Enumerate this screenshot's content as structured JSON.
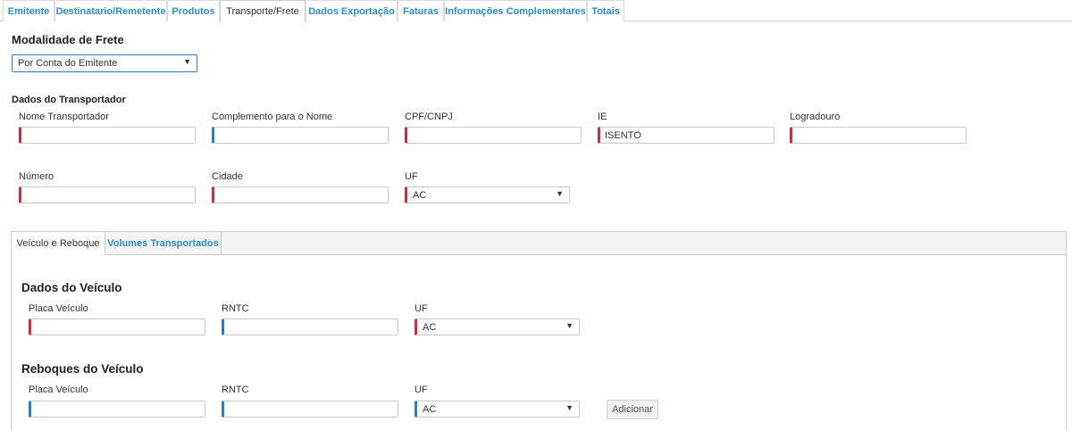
{
  "tabs": [
    {
      "label": "Emitente"
    },
    {
      "label": "Destinatario/Remetente"
    },
    {
      "label": "Produtos"
    },
    {
      "label": "Transporte/Frete"
    },
    {
      "label": "Dados Exportação"
    },
    {
      "label": "Faturas"
    },
    {
      "label": "Informações Complementares"
    },
    {
      "label": "Totais"
    }
  ],
  "frete": {
    "title": "Modalidade de Frete",
    "selected": "Por Conta do Emitente"
  },
  "transportador": {
    "title": "Dados do Transportador",
    "nome_label": "Nome Transportador",
    "nome_value": "",
    "complemento_label": "Complemento para o Nome",
    "complemento_value": "",
    "cpf_label": "CPF/CNPJ",
    "cpf_value": "",
    "ie_label": "IE",
    "ie_value": "ISENTO",
    "logradouro_label": "Logradouro",
    "logradouro_value": "",
    "numero_label": "Número",
    "numero_value": "",
    "cidade_label": "Cidade",
    "cidade_value": "",
    "uf_label": "UF",
    "uf_value": "AC"
  },
  "subtabs": [
    {
      "label": "Veículo e Reboque"
    },
    {
      "label": "Volumes Transportados"
    }
  ],
  "veiculo": {
    "title": "Dados do Veículo",
    "placa_label": "Placa Veículo",
    "placa_value": "",
    "rntc_label": "RNTC",
    "rntc_value": "",
    "uf_label": "UF",
    "uf_value": "AC"
  },
  "reboques": {
    "title": "Reboques do Veículo",
    "placa_label": "Placa Veículo",
    "placa_value": "",
    "rntc_label": "RNTC",
    "rntc_value": "",
    "uf_label": "UF",
    "uf_value": "AC",
    "add_button": "Adicionar"
  },
  "icons": {
    "caret": "▼"
  },
  "colors": {
    "link": "#2a8fd0",
    "required": "#d9283c",
    "optional": "#2a7fc4"
  }
}
